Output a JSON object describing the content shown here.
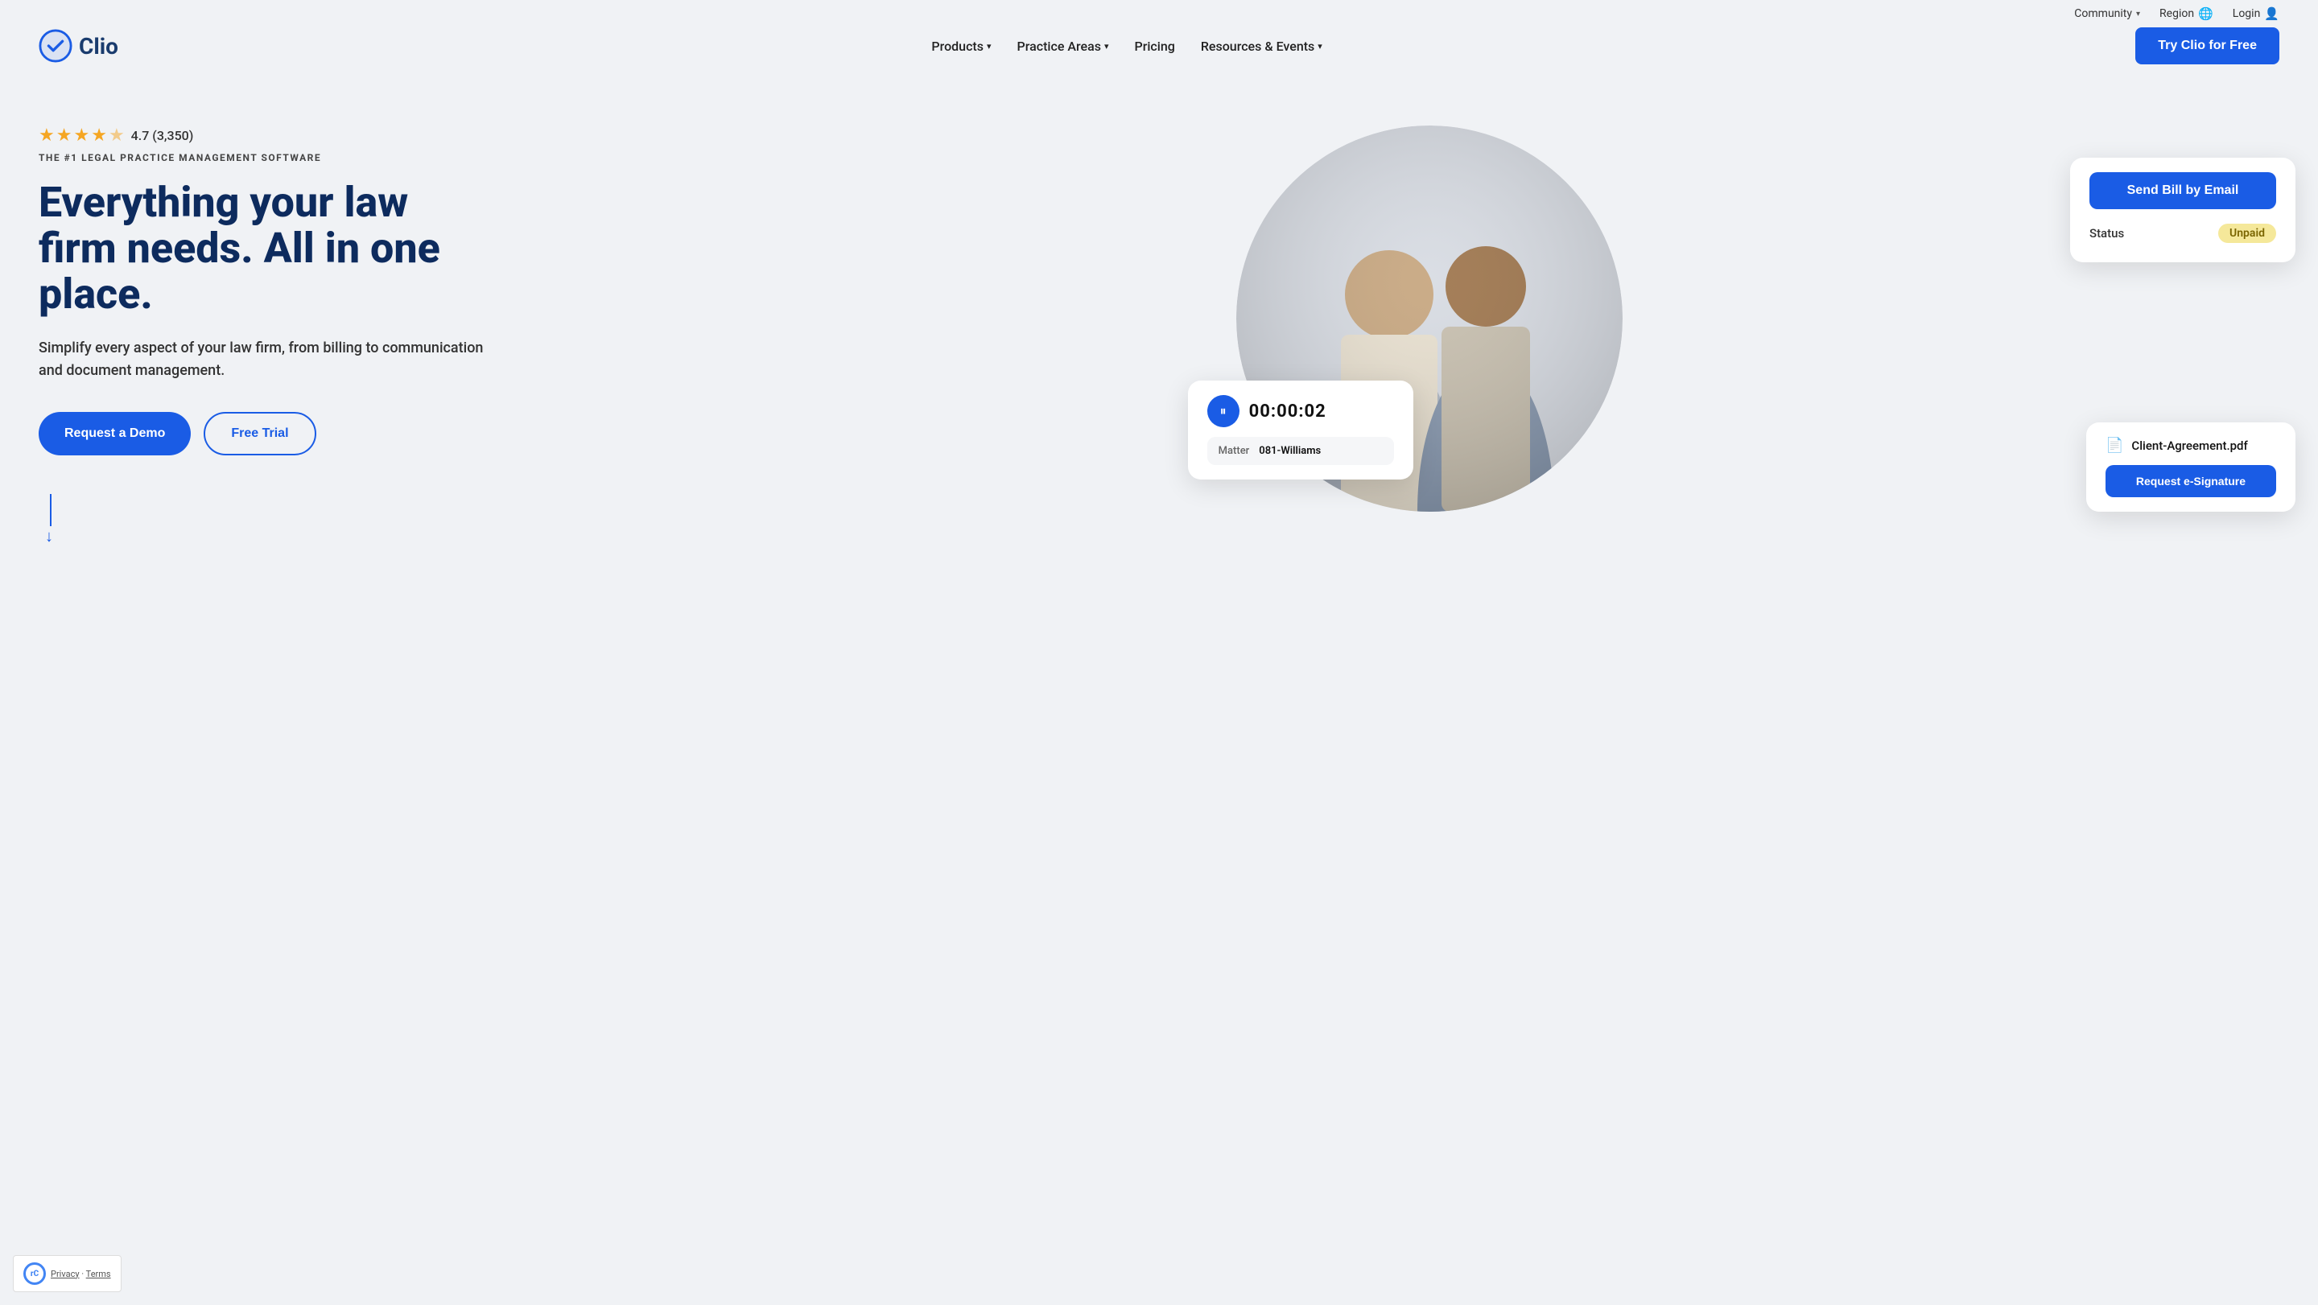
{
  "topbar": {
    "community_label": "Community",
    "region_label": "Region",
    "login_label": "Login"
  },
  "nav": {
    "logo_text": "Clio",
    "products_label": "Products",
    "practice_areas_label": "Practice Areas",
    "pricing_label": "Pricing",
    "resources_label": "Resources & Events",
    "cta_label": "Try Clio for Free"
  },
  "hero": {
    "rating_score": "4.7 (3,350)",
    "tagline": "THE #1 LEGAL PRACTICE MANAGEMENT SOFTWARE",
    "headline_line1": "Everything your law",
    "headline_line2": "firm needs. All in one",
    "headline_line3": "place.",
    "subtext": "Simplify every aspect of your law firm, from billing to communication and document management.",
    "demo_btn": "Request a Demo",
    "trial_btn": "Free Trial"
  },
  "cards": {
    "timer": {
      "time": "00:00:02",
      "matter_label": "Matter",
      "matter_value": "081-Williams"
    },
    "email": {
      "send_btn": "Send Bill by Email",
      "status_label": "Status",
      "status_badge": "Unpaid"
    },
    "doc": {
      "doc_name": "Client-Agreement.pdf",
      "esign_btn": "Request e-Signature"
    }
  },
  "recaptcha": {
    "privacy": "Privacy",
    "terms": "Terms"
  }
}
